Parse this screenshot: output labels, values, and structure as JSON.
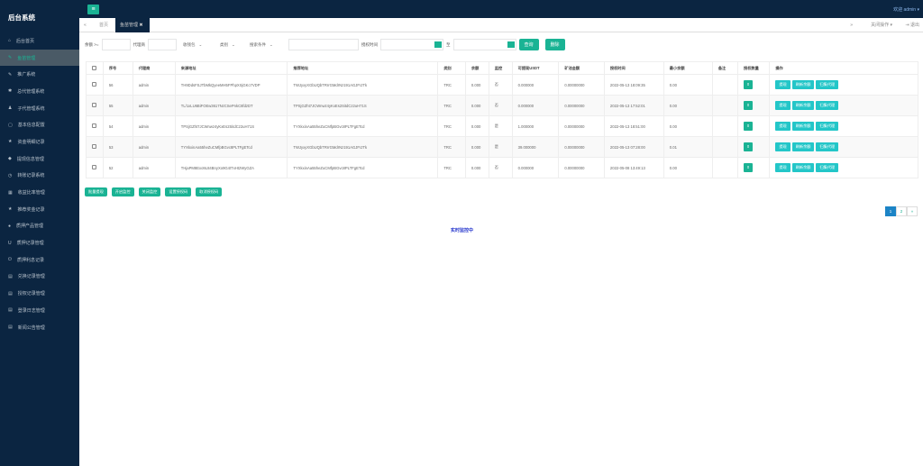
{
  "app_title": "后台系统",
  "sidebar": {
    "items": [
      {
        "label": "后台首页",
        "icon": "home-icon"
      },
      {
        "label": "鱼苗管理",
        "icon": "wrench-icon",
        "active": true
      },
      {
        "label": "推广系统",
        "icon": "edit-icon"
      },
      {
        "label": "总代管理系统",
        "icon": "gear-icon"
      },
      {
        "label": "子代管理系统",
        "icon": "users-icon"
      },
      {
        "label": "基本信息配置",
        "icon": "file-icon"
      },
      {
        "label": "资金明细记录",
        "icon": "star-icon"
      },
      {
        "label": "提现信息管理",
        "icon": "tag-icon"
      },
      {
        "label": "转账记录系统",
        "icon": "clock-icon"
      },
      {
        "label": "收益比率管理",
        "icon": "calendar-icon"
      },
      {
        "label": "推荐奖金记录",
        "icon": "star-icon"
      },
      {
        "label": "质押产品管理",
        "icon": "comment-icon"
      },
      {
        "label": "质押记录管理",
        "icon": "magnet-icon"
      },
      {
        "label": "质押利息记录",
        "icon": "power-icon"
      },
      {
        "label": "兑换记录管理",
        "icon": "copy-icon"
      },
      {
        "label": "授权记录管理",
        "icon": "copy-icon"
      },
      {
        "label": "登录日志管理",
        "icon": "copy-icon"
      },
      {
        "label": "新闻公告管理",
        "icon": "copy-icon"
      }
    ]
  },
  "topbar": {
    "welcome": "欢迎 admin ▾"
  },
  "tabs": {
    "home": "首页",
    "current": "鱼苗管理",
    "close_ops": "关闭操作 ▾",
    "logout": "退出"
  },
  "filters": {
    "balance_label": "余额 >=",
    "agent_label": "代理商",
    "sel_monitor": "收钱包",
    "sel_type": "类别",
    "sel_search": "搜索条件",
    "time_label": "授权时间",
    "to_label": "至",
    "search_btn": "查询",
    "delete_btn": "删除"
  },
  "table": {
    "headers": [
      "序号",
      "代理商",
      "来源地址",
      "推荐地址",
      "类别",
      "余额",
      "监控",
      "可提现USDT",
      "矿池金额",
      "授权时间",
      "最小余额",
      "备注",
      "授权数量",
      "操作"
    ],
    "rows": [
      [
        "56",
        "admin",
        "TH9DdsFSJTbMkQyeeMH5FPhpXSjGKc7VDP",
        "TWJyxyXGbUQbTRrrGMdrNz191AGJFrJTk",
        "TRC",
        "0.000",
        "否",
        "0.000000",
        "0.00000000",
        "2022-05-13 18:09:35",
        "0.00",
        "",
        "0"
      ],
      [
        "55",
        "admin",
        "TL/1xLU6BiFOEw3617NzCSePnkC8fdzDT",
        "TPSjGZht7JCWnwz4yKxEs2SitdCz2uH71S",
        "TRC",
        "0.000",
        "否",
        "0.000000",
        "0.00000000",
        "2022-05-13 17:52:01",
        "0.00",
        "",
        "0"
      ],
      [
        "54",
        "admin",
        "TPSjGZht7JCWnwz4yKxEs2SitdCz2uH71S",
        "TYXkxinAa55heZuCMfpBGvc8PLTFgETcd",
        "TRC",
        "0.000",
        "是",
        "1.000000",
        "0.00000000",
        "2022-05-13 18:51:00",
        "0.00",
        "",
        "0"
      ],
      [
        "53",
        "admin",
        "TYXkxinAa55heZuCMfpBGvc8PLTFgETcd",
        "TWJyxyXGbUQbTRrrGMdrNz191AGJFrJTk",
        "TRC",
        "0.000",
        "是",
        "39.000000",
        "0.00000000",
        "2022-05-13 07:28:00",
        "0.01",
        "",
        "0"
      ],
      [
        "52",
        "admin",
        "THjaPM8Exo9L84BnyXo9G4tTxHt2WyGZA",
        "TYXkxinAa55heZuCMfpBGvc8PLTFgETcd",
        "TRC",
        "0.000",
        "否",
        "0.000000",
        "0.00000000",
        "2022-05-08 13:49:13",
        "0.00",
        "",
        "0"
      ]
    ],
    "ops": [
      "提现",
      "刷新余额",
      "归集代理"
    ]
  },
  "bulk": [
    "批量提现",
    "开启监控",
    "关闭监控",
    "设置授权码",
    "取消授权码"
  ],
  "pager": [
    "1",
    "2",
    "»"
  ],
  "footer": "实时监控中",
  "colors": {
    "sidebar": "#0b2541",
    "accent": "#1ab394",
    "info": "#23c6c8",
    "page_active": "#1c84c6"
  }
}
